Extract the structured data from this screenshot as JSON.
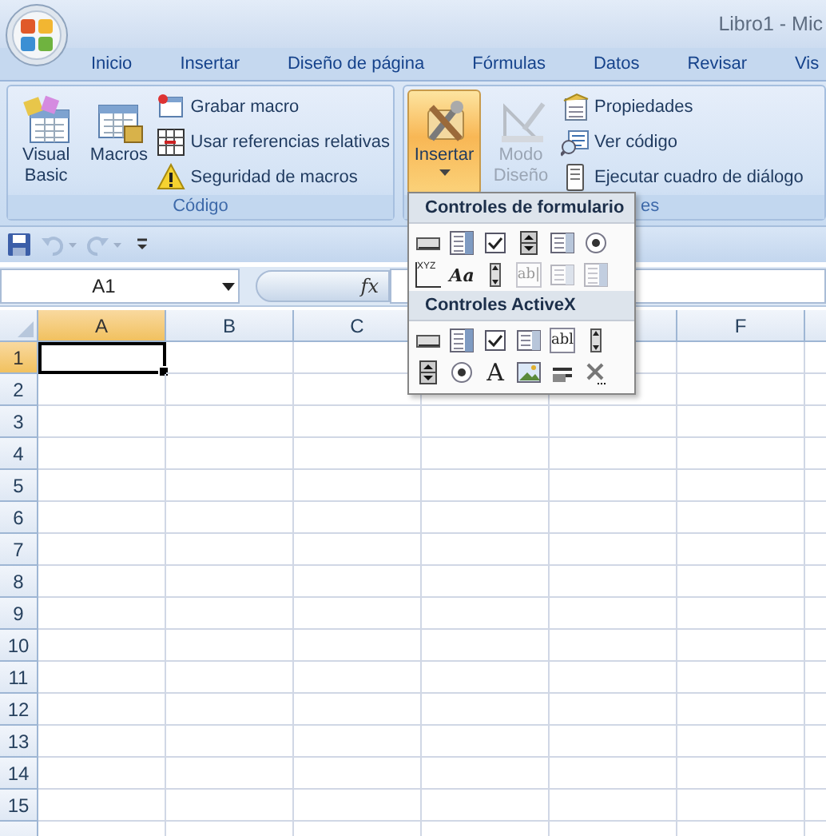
{
  "window": {
    "title": "Libro1 - Mic"
  },
  "tabs": [
    {
      "label": "Inicio",
      "selected": false
    },
    {
      "label": "Insertar",
      "selected": false
    },
    {
      "label": "Diseño de página",
      "selected": false
    },
    {
      "label": "Fórmulas",
      "selected": false
    },
    {
      "label": "Datos",
      "selected": false
    },
    {
      "label": "Revisar",
      "selected": false
    },
    {
      "label": "Vis",
      "selected": false
    }
  ],
  "ribbon": {
    "groups": [
      {
        "label": "Código",
        "large_buttons": [
          {
            "label": "Visual Basic",
            "pressed": false,
            "disabled": false
          },
          {
            "label": "Macros",
            "pressed": false,
            "disabled": false
          }
        ],
        "small_buttons": [
          {
            "label": "Grabar macro"
          },
          {
            "label": "Usar referencias relativas"
          },
          {
            "label": "Seguridad de macros"
          }
        ]
      },
      {
        "label": "es",
        "large_buttons": [
          {
            "label": "Insertar",
            "pressed": true,
            "disabled": false,
            "dropdown": true
          },
          {
            "label": "Modo Diseño",
            "pressed": false,
            "disabled": true
          }
        ],
        "small_buttons": [
          {
            "label": "Propiedades"
          },
          {
            "label": "Ver código"
          },
          {
            "label": "Ejecutar cuadro de diálogo"
          }
        ]
      }
    ]
  },
  "quick_access": [
    {
      "kind": "save",
      "disabled": false
    },
    {
      "kind": "undo",
      "disabled": true
    },
    {
      "kind": "redo",
      "disabled": true
    },
    {
      "kind": "customize",
      "disabled": false
    }
  ],
  "formula_bar": {
    "name_box": "A1",
    "function_label": "fx"
  },
  "insert_menu": {
    "sections": [
      {
        "title": "Controles de formulario",
        "controls": [
          {
            "kind": "button",
            "disabled": false
          },
          {
            "kind": "combo",
            "disabled": false
          },
          {
            "kind": "checkbox",
            "disabled": false
          },
          {
            "kind": "spin",
            "disabled": false
          },
          {
            "kind": "listbox",
            "disabled": false
          },
          {
            "kind": "option",
            "disabled": false
          },
          {
            "kind": "groupbox",
            "glyph": "XYZ",
            "disabled": false
          },
          {
            "kind": "label",
            "glyph": "Aa",
            "disabled": false
          },
          {
            "kind": "scrollbar",
            "disabled": false
          },
          {
            "kind": "textfield",
            "glyph": "ab|",
            "disabled": true
          },
          {
            "kind": "listbox",
            "disabled": true
          },
          {
            "kind": "combo",
            "disabled": true
          }
        ]
      },
      {
        "title": "Controles ActiveX",
        "controls": [
          {
            "kind": "button",
            "disabled": false
          },
          {
            "kind": "combo",
            "disabled": false
          },
          {
            "kind": "checkbox",
            "disabled": false
          },
          {
            "kind": "listbox",
            "disabled": false
          },
          {
            "kind": "textfield",
            "glyph": "abl",
            "disabled": false
          },
          {
            "kind": "scrollbar",
            "disabled": false
          },
          {
            "kind": "spin",
            "disabled": false
          },
          {
            "kind": "option",
            "disabled": false
          },
          {
            "kind": "label",
            "glyph": "A",
            "disabled": false
          },
          {
            "kind": "image",
            "disabled": false
          },
          {
            "kind": "toggle",
            "disabled": false
          },
          {
            "kind": "more",
            "disabled": false
          }
        ]
      }
    ]
  },
  "sheet": {
    "columns": [
      {
        "label": "A",
        "selected": true
      },
      {
        "label": "B",
        "selected": false
      },
      {
        "label": "C",
        "selected": false
      },
      {},
      {
        "selected": false
      },
      {
        "label": "F",
        "selected": false
      }
    ],
    "rows": [
      {
        "label": "1",
        "selected": true
      },
      {
        "label": "2",
        "selected": false
      },
      {
        "label": "3",
        "selected": false
      },
      {
        "label": "4",
        "selected": false
      },
      {
        "label": "5",
        "selected": false
      },
      {
        "label": "6",
        "selected": false
      },
      {
        "label": "7",
        "selected": false
      },
      {
        "label": "8",
        "selected": false
      },
      {
        "label": "9",
        "selected": false
      },
      {
        "label": "10",
        "selected": false
      },
      {
        "label": "11",
        "selected": false
      },
      {
        "label": "12",
        "selected": false
      },
      {
        "label": "13",
        "selected": false
      },
      {
        "label": "14",
        "selected": false
      },
      {
        "label": "15",
        "selected": false
      }
    ]
  }
}
